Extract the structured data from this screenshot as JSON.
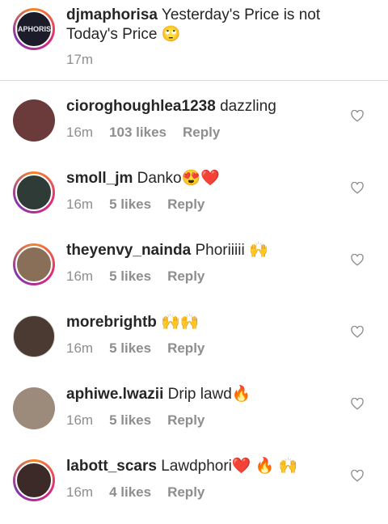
{
  "caption": {
    "username": "djmaphorisa",
    "text": "Yesterday's Price is not Today's Price 🙄",
    "time": "17m",
    "avatar_color": "#1b1b2a"
  },
  "comments": [
    {
      "username": "cioroghoughlea1238",
      "text": "dazzling",
      "time": "16m",
      "likes": "103 likes",
      "reply": "Reply",
      "avatar_color": "#6b3b3b"
    },
    {
      "username": "smoll_jm",
      "text": "Danko😍❤️",
      "time": "16m",
      "likes": "5 likes",
      "reply": "Reply",
      "avatar_color": "#2f3b36"
    },
    {
      "username": "theyenvy_nainda",
      "text": "Phoriiiii 🙌",
      "time": "16m",
      "likes": "5 likes",
      "reply": "Reply",
      "avatar_color": "#8a6f58"
    },
    {
      "username": "morebrightb",
      "text": "🙌🙌",
      "time": "16m",
      "likes": "5 likes",
      "reply": "Reply",
      "avatar_color": "#4a3a32"
    },
    {
      "username": "aphiwe.lwazii",
      "text": "Drip lawd🔥",
      "time": "16m",
      "likes": "5 likes",
      "reply": "Reply",
      "avatar_color": "#9c8a7a"
    },
    {
      "username": "labott_scars",
      "text": "Lawdphori❤️ 🔥 🙌",
      "time": "16m",
      "likes": "4 likes",
      "reply": "Reply",
      "avatar_color": "#3b2a28"
    }
  ]
}
